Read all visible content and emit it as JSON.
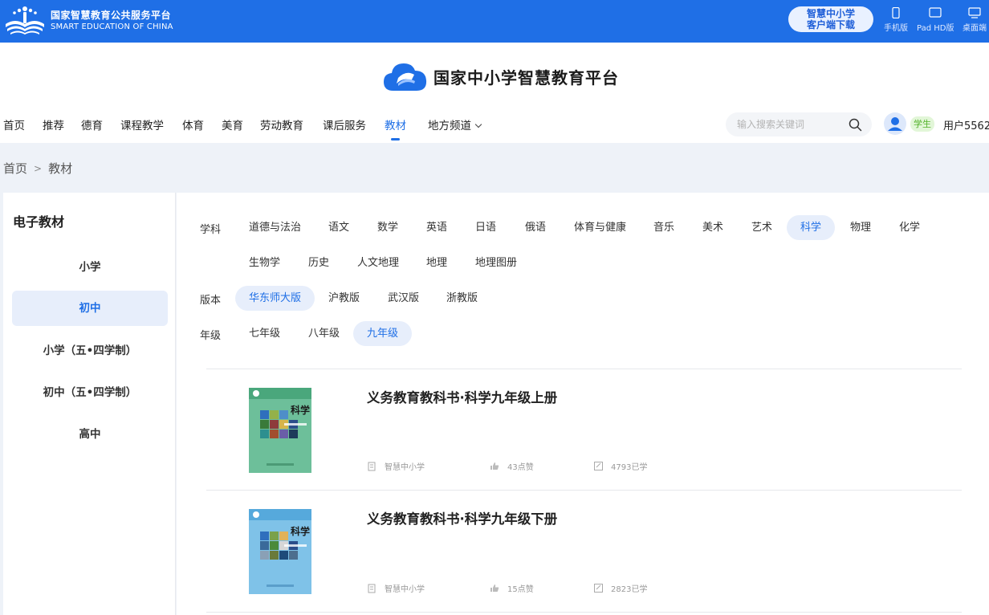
{
  "topbar": {
    "brand_cn": "国家智慧教育公共服务平台",
    "brand_en": "SMART EDUCATION OF CHINA",
    "download_line1": "智慧中小学",
    "download_line2": "客户端下载",
    "devices": [
      {
        "label": "手机版",
        "icon": "phone-icon"
      },
      {
        "label": "Pad HD版",
        "icon": "tablet-icon"
      },
      {
        "label": "桌面端",
        "icon": "desktop-icon"
      }
    ]
  },
  "header": {
    "platform_title": "国家中小学智慧教育平台",
    "nav": [
      "首页",
      "推荐",
      "德育",
      "课程教学",
      "体育",
      "美育",
      "劳动教育",
      "课后服务",
      "教材",
      "地方频道"
    ],
    "nav_active": "教材",
    "search_placeholder": "输入搜索关键词",
    "role_badge": "学生",
    "username": "用户5562"
  },
  "breadcrumb": {
    "home": "首页",
    "separator": ">",
    "current": "教材"
  },
  "sidebar": {
    "title": "电子教材",
    "items": [
      "小学",
      "初中",
      "小学（五•四学制）",
      "初中（五•四学制）",
      "高中"
    ],
    "active": "初中"
  },
  "filters": {
    "subject_label": "学科",
    "subjects_row1": [
      "道德与法治",
      "语文",
      "数学",
      "英语",
      "日语",
      "俄语",
      "体育与健康",
      "音乐",
      "美术",
      "艺术",
      "科学",
      "物理",
      "化学"
    ],
    "subjects_row2": [
      "生物学",
      "历史",
      "人文地理",
      "地理",
      "地理图册"
    ],
    "subject_active": "科学",
    "edition_label": "版本",
    "editions": [
      "华东师大版",
      "沪教版",
      "武汉版",
      "浙教版"
    ],
    "edition_active": "华东师大版",
    "grade_label": "年级",
    "grades": [
      "七年级",
      "八年级",
      "九年级"
    ],
    "grade_active": "九年级"
  },
  "books": [
    {
      "title": "义务教育教科书·科学九年级上册",
      "publisher": "智慧中小学",
      "likes": "43点赞",
      "learners": "4793已学",
      "cover_title": "科学",
      "cover_color": "#6dbf9a"
    },
    {
      "title": "义务教育教科书·科学九年级下册",
      "publisher": "智慧中小学",
      "likes": "15点赞",
      "learners": "2823已学",
      "cover_title": "科学",
      "cover_color": "#7fc2e8"
    }
  ],
  "colors": {
    "primary": "#1f6fe6",
    "active_bg": "#e7eefb",
    "badge_green": "#54b32c"
  }
}
